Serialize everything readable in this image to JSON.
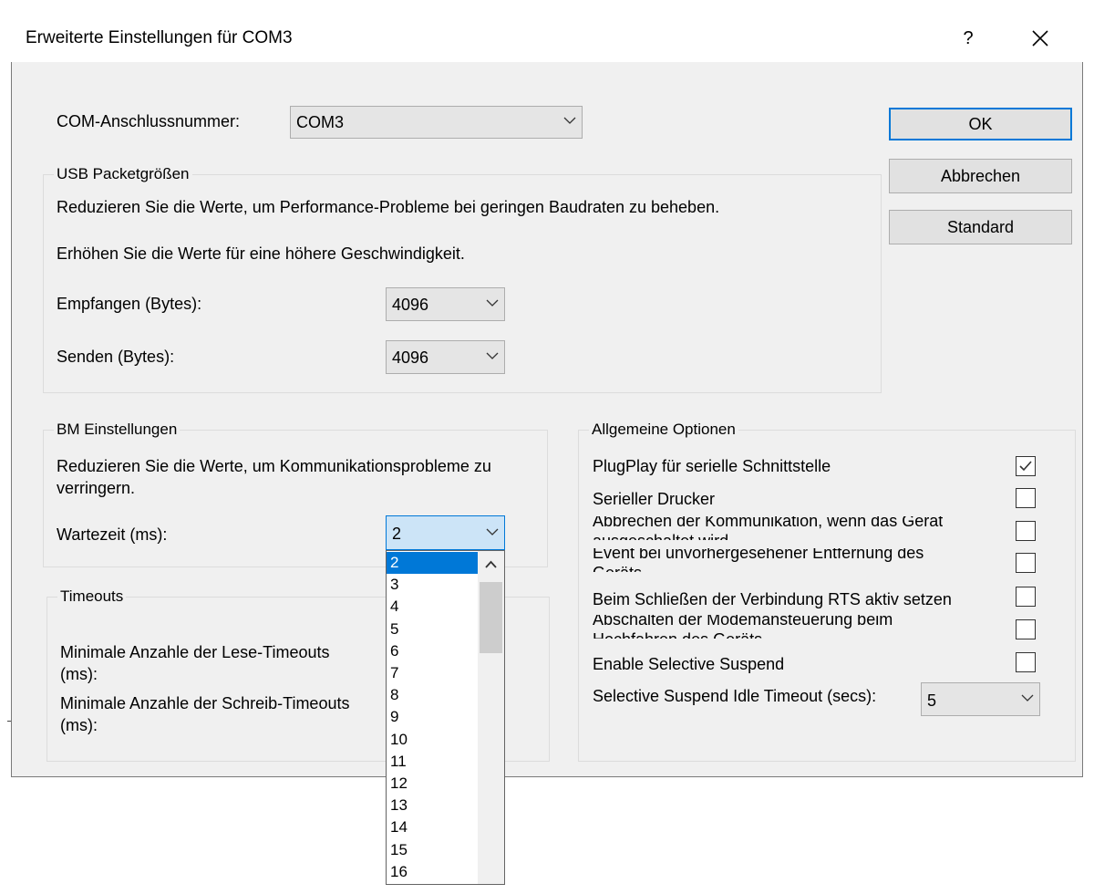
{
  "window": {
    "title": "Erweiterte Einstellungen für COM3",
    "help_label": "?",
    "close_label": "✕"
  },
  "com_port": {
    "label": "COM-Anschlussnummer:",
    "value": "COM3"
  },
  "buttons": {
    "ok": "OK",
    "cancel": "Abbrechen",
    "default": "Standard"
  },
  "usb_group": {
    "legend": "USB Packetgrößen",
    "desc1": "Reduzieren Sie die Werte, um Performance-Probleme bei geringen Baudraten zu beheben.",
    "desc2": "Erhöhen Sie die Werte für eine höhere Geschwindigkeit.",
    "receive_label": "Empfangen (Bytes):",
    "receive_value": "4096",
    "send_label": "Senden (Bytes):",
    "send_value": "4096"
  },
  "bm_group": {
    "legend": "BM Einstellungen",
    "desc_line1": "Reduzieren Sie die Werte, um Kommunikationsprobleme zu",
    "desc_line2": "verringern.",
    "latency_label": "Wartezeit (ms):",
    "latency_value": "2"
  },
  "timeouts_group": {
    "legend": "Timeouts",
    "read_line1": "Minimale Anzahle der Lese-Timeouts",
    "read_line2": "(ms):",
    "write_line1": "Minimale Anzahle der Schreib-Timeouts",
    "write_line2": "(ms):"
  },
  "general_group": {
    "legend": "Allgemeine Optionen",
    "options": [
      {
        "label": "PlugPlay für serielle Schnittstelle",
        "checked": true
      },
      {
        "label": "Serieller Drucker",
        "checked": false
      },
      {
        "label": "Abbrechen der Kommunikation, wenn das Gerät",
        "label2": "ausgeschaltet wird",
        "checked": false
      },
      {
        "label": "Event bei unvorhergesehener Entfernung des",
        "label2": "Geräts",
        "checked": false
      },
      {
        "label": "Beim Schließen der Verbindung RTS aktiv setzen",
        "checked": false
      },
      {
        "label": "Abschalten der Modemansteuerung beim",
        "label2": "Hochfahren des Geräts",
        "checked": false
      },
      {
        "label": "Enable Selective Suspend",
        "checked": false
      }
    ],
    "idle_label": "Selective Suspend Idle Timeout (secs):",
    "idle_value": "5"
  },
  "latency_dropdown": {
    "items": [
      "2",
      "3",
      "4",
      "5",
      "6",
      "7",
      "8",
      "9",
      "10",
      "11",
      "12",
      "13",
      "14",
      "15",
      "16"
    ],
    "selected": "2"
  },
  "colors": {
    "accent": "#0078d7",
    "dialog_bg": "#f0f0f0",
    "combo_focus_bg": "#cce4f7"
  },
  "icons": {
    "chevron": "chevron-down-icon",
    "check": "check-icon",
    "scroll_up": "arrow-up-icon"
  }
}
